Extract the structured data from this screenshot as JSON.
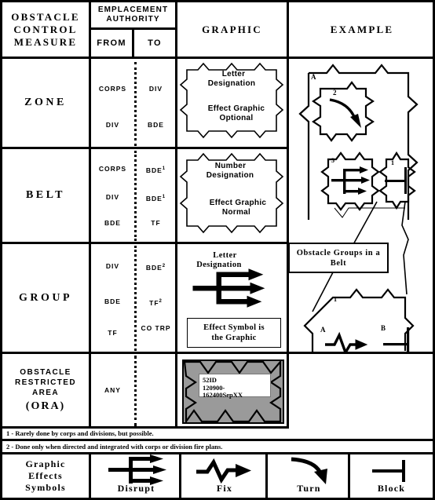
{
  "table": {
    "headers": {
      "measure": "OBSTACLE CONTROL MEASURE",
      "authority": "EMPLACEMENT AUTHORITY",
      "from": "FROM",
      "to": "TO",
      "graphic": "GRAPHIC",
      "example": "EXAMPLE"
    },
    "rows": [
      {
        "name": "ZONE",
        "authority": [
          {
            "from": "CORPS",
            "to": "DIV"
          },
          {
            "from": "DIV",
            "to": "BDE"
          }
        ],
        "graphic": {
          "shape": "zigzag-polygon",
          "line1": "Letter",
          "line2": "Designation",
          "line3": "Effect Graphic",
          "line4": "Optional"
        },
        "example": {
          "zone_label": "A",
          "belt_label": "2",
          "effect": "turn"
        }
      },
      {
        "name": "BELT",
        "authority": [
          {
            "from": "CORPS",
            "to": "BDE",
            "to_note": "1"
          },
          {
            "from": "DIV",
            "to": "BDE",
            "to_note": "1"
          },
          {
            "from": "BDE",
            "to": "TF"
          }
        ],
        "graphic": {
          "shape": "zigzag-polygon",
          "line1": "Number",
          "line2": "Designation",
          "line3": "Effect Graphic",
          "line4": "Normal"
        },
        "example": {
          "group_left_label": "3",
          "group_left_effect": "disrupt",
          "group_right_label": "1",
          "group_right_effect": "block",
          "callout": "Obstacle Groups in a Belt"
        }
      },
      {
        "name": "GROUP",
        "authority": [
          {
            "from": "DIV",
            "to": "BDE",
            "to_note": "2"
          },
          {
            "from": "BDE",
            "to": "TF",
            "to_note": "2"
          },
          {
            "from": "TF",
            "to": "CO TRP"
          }
        ],
        "graphic": {
          "shape": "disrupt-arrows",
          "line1": "Letter",
          "line2": "Designation",
          "box_line1": "Effect Symbol is",
          "box_line2": "the Graphic"
        },
        "example": {
          "belt_label": "1",
          "group_a_label": "A",
          "group_a_effect": "fix",
          "group_b_label": "B",
          "group_b_effect": "block"
        }
      },
      {
        "name": "OBSTACLE RESTRICTED AREA",
        "name_paren": "(ORA)",
        "authority": [
          {
            "from": "ANY",
            "to": ""
          }
        ],
        "graphic": {
          "shape": "gray-zigzag-block",
          "label_line1": "52ID",
          "label_line2": "120900-",
          "label_line3": "162400SepXX",
          "fill_color": "#9a9a9a"
        },
        "example": {}
      }
    ],
    "footnotes": [
      "1 - Rarely done by corps and divisions, but possible.",
      "2 - Done only when directed and integrated with corps or division fire plans."
    ],
    "effects_row": {
      "label_line1": "Graphic",
      "label_line2": "Effects",
      "label_line3": "Symbols",
      "symbols": [
        {
          "name": "disrupt",
          "label": "Disrupt"
        },
        {
          "name": "fix",
          "label": "Fix"
        },
        {
          "name": "turn",
          "label": "Turn"
        },
        {
          "name": "block",
          "label": "Block"
        }
      ]
    }
  }
}
